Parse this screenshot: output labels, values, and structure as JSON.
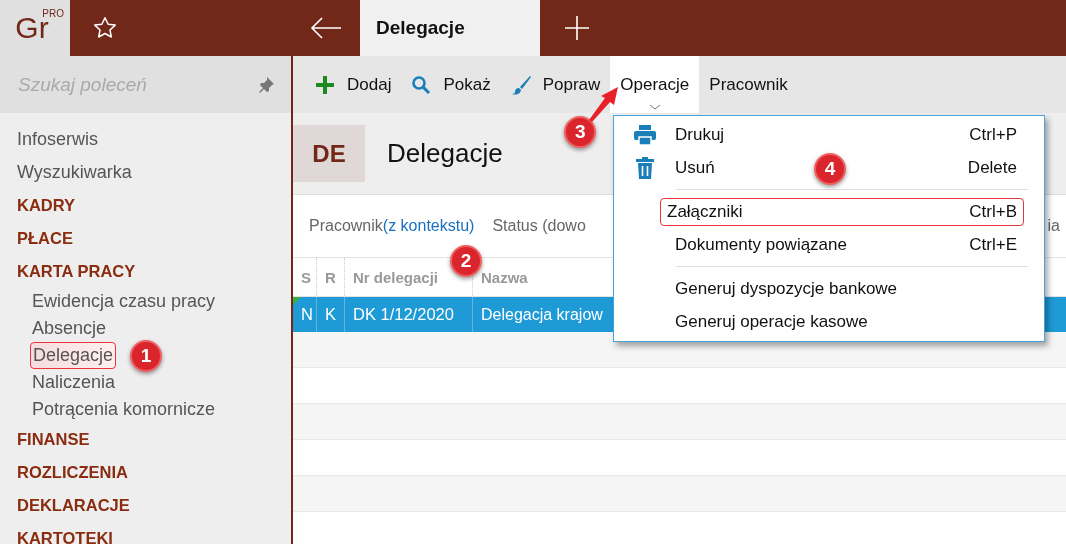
{
  "logo": {
    "text": "Gr",
    "badge": "PRO"
  },
  "tabs": [
    {
      "label": "Delegacje",
      "selected": true
    }
  ],
  "sidebar": {
    "search": {
      "placeholder": "Szukaj poleceń"
    },
    "items": [
      {
        "label": "Infoserwis",
        "kind": "link",
        "selected": false
      },
      {
        "label": "Wyszukiwarka",
        "kind": "link",
        "selected": false
      },
      {
        "label": "KADRY",
        "kind": "section",
        "selected": false
      },
      {
        "label": "PŁACE",
        "kind": "section",
        "selected": false
      },
      {
        "label": "KARTA PRACY",
        "kind": "section",
        "selected": false,
        "children": [
          {
            "label": "Ewidencja czasu pracy",
            "selected": false
          },
          {
            "label": "Absencje",
            "selected": false
          },
          {
            "label": "Delegacje",
            "selected": true,
            "callout": "1"
          },
          {
            "label": "Naliczenia",
            "selected": false
          },
          {
            "label": "Potrącenia komornicze",
            "selected": false
          }
        ]
      },
      {
        "label": "FINANSE",
        "kind": "section",
        "selected": false
      },
      {
        "label": "ROZLICZENIA",
        "kind": "section",
        "selected": false
      },
      {
        "label": "DEKLARACJE",
        "kind": "section",
        "selected": false
      },
      {
        "label": "KARTOTEKI",
        "kind": "section",
        "selected": false
      }
    ]
  },
  "toolbar": [
    {
      "label": "Dodaj",
      "kind": "add",
      "open": false
    },
    {
      "label": "Pokaż",
      "kind": "show",
      "open": false
    },
    {
      "label": "Popraw",
      "kind": "edit",
      "open": false
    },
    {
      "label": "Operacje",
      "kind": "text",
      "open": true,
      "callout": "3"
    },
    {
      "label": "Pracownik",
      "kind": "text",
      "open": false
    }
  ],
  "header": {
    "badge": "DE",
    "title": "Delegacje"
  },
  "filters": [
    {
      "label": "Pracownik",
      "value": "(z kontekstu)"
    },
    {
      "label": "Status (dowo"
    },
    {
      "label": "ia"
    }
  ],
  "table": {
    "columns": [
      "S",
      "R",
      "Nr delegacji",
      "Nazwa"
    ],
    "rows": [
      {
        "cells": [
          "N",
          "K",
          "DK 1/12/2020",
          "Delegacja krajow"
        ],
        "selected": true,
        "callout": "2"
      }
    ]
  },
  "menu": {
    "groups": [
      [
        {
          "label": "Drukuj",
          "shortcut": "Ctrl+P",
          "kind": "print",
          "selected": false
        },
        {
          "label": "Usuń",
          "shortcut": "Delete",
          "kind": "delete",
          "selected": false
        }
      ],
      [
        {
          "label": "Załączniki",
          "shortcut": "Ctrl+B",
          "kind": "text",
          "selected": true,
          "callout": "4"
        },
        {
          "label": "Dokumenty powiązane",
          "shortcut": "Ctrl+E",
          "kind": "text",
          "selected": false
        }
      ],
      [
        {
          "label": "Generuj dyspozycje bankowe",
          "kind": "text",
          "selected": false
        },
        {
          "label": "Generuj operacje kasowe",
          "kind": "text",
          "selected": false
        }
      ]
    ]
  }
}
